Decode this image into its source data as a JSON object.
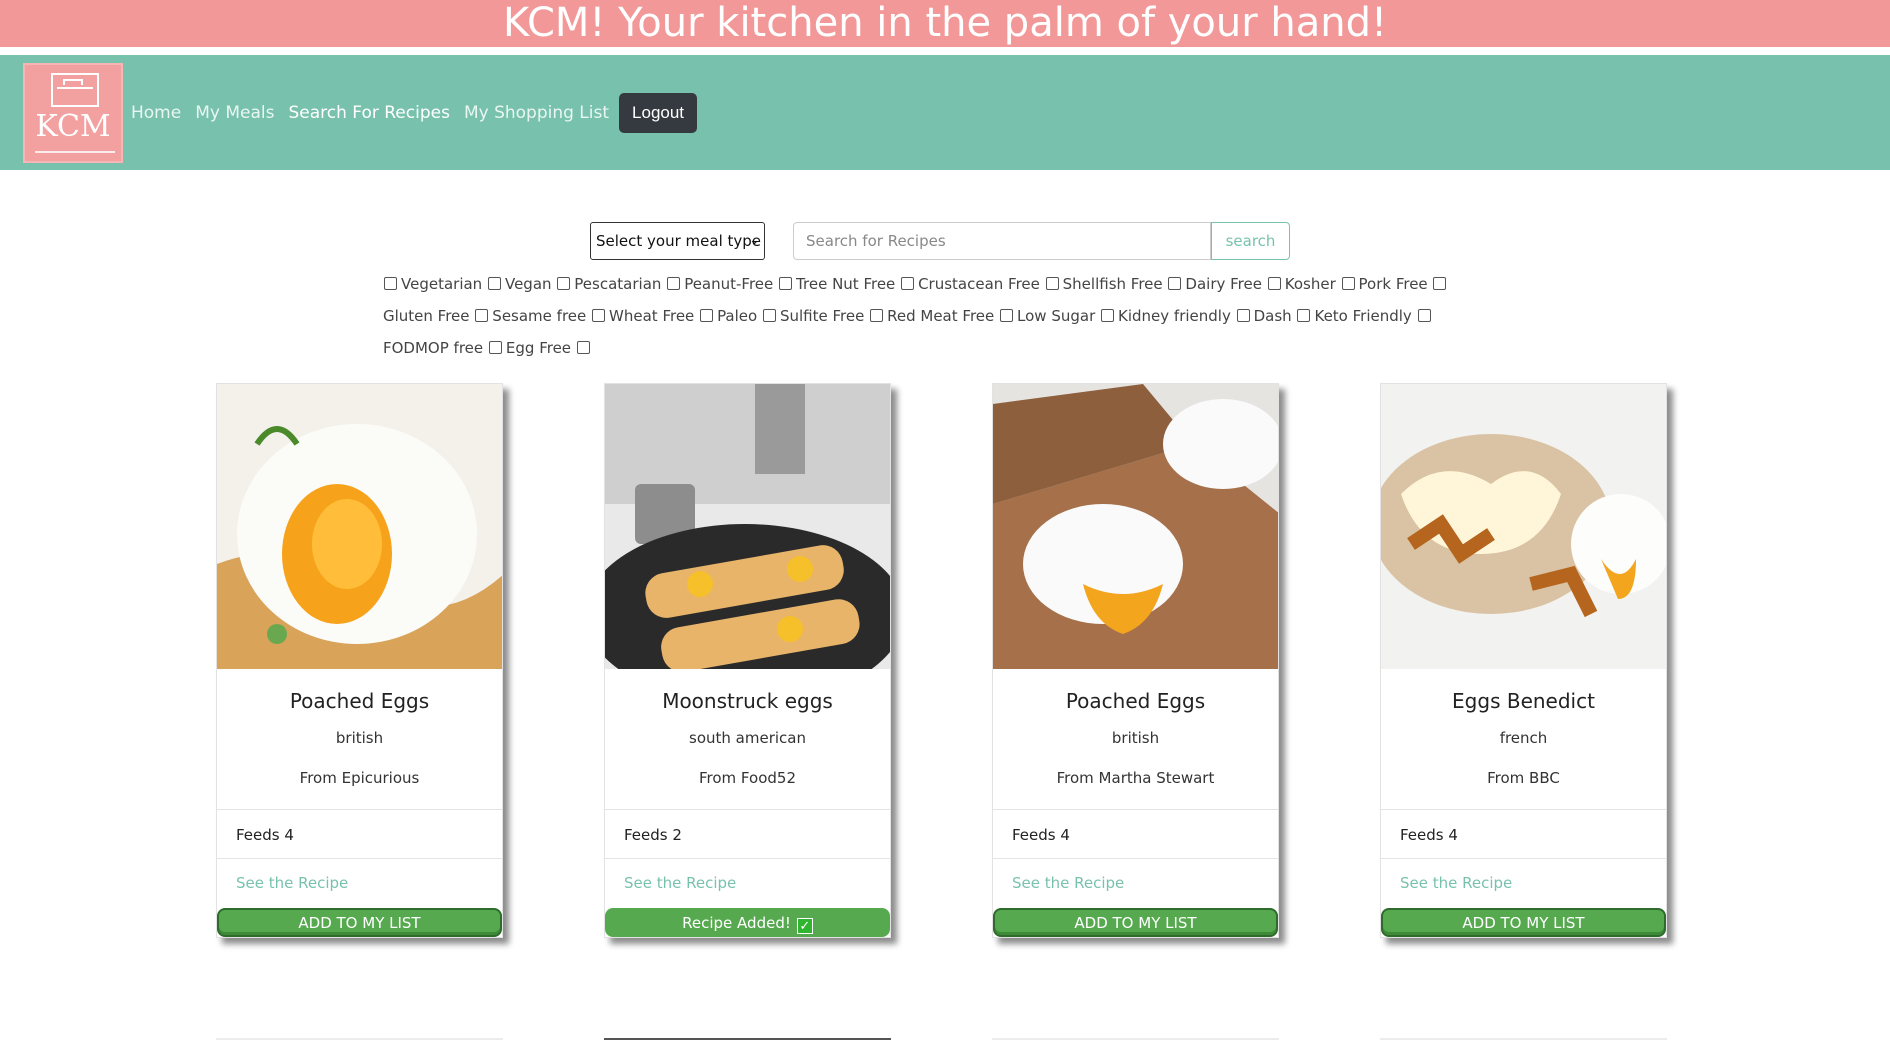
{
  "banner": {
    "text": "KCM! Your kitchen in the palm of your hand!"
  },
  "nav": {
    "logo_text": "KCM",
    "links": [
      {
        "label": "Home"
      },
      {
        "label": "My Meals"
      },
      {
        "label": "Search For Recipes"
      },
      {
        "label": "My Shopping List"
      }
    ],
    "logout_label": "Logout"
  },
  "search": {
    "meal_type_selected": "Select your meal type",
    "placeholder": "Search for Recipes",
    "button_label": "search"
  },
  "filters": [
    "Vegetarian",
    "Vegan",
    "Pescatarian",
    "Peanut-Free",
    "Tree Nut Free",
    "Crustacean Free",
    "Shellfish Free",
    "Dairy Free",
    "Kosher",
    "Pork Free",
    "Gluten Free",
    "Sesame free",
    "Wheat Free",
    "Paleo",
    "Sulfite Free",
    "Red Meat Free",
    "Low Sugar",
    "Kidney friendly",
    "Dash",
    "Keto Friendly",
    "FODMOP free",
    "Egg Free"
  ],
  "recipes": [
    {
      "title": "Poached Eggs",
      "cuisine": "british",
      "source": "From Epicurious",
      "feeds": "Feeds 4",
      "link": "See the Recipe",
      "button": "ADD TO MY LIST",
      "added": false
    },
    {
      "title": "Moonstruck eggs",
      "cuisine": "south american",
      "source": "From Food52",
      "feeds": "Feeds 2",
      "link": "See the Recipe",
      "button": "Recipe Added!",
      "added": true
    },
    {
      "title": "Poached Eggs",
      "cuisine": "british",
      "source": "From Martha Stewart",
      "feeds": "Feeds 4",
      "link": "See the Recipe",
      "button": "ADD TO MY LIST",
      "added": false
    },
    {
      "title": "Eggs Benedict",
      "cuisine": "french",
      "source": "From BBC",
      "feeds": "Feeds 4",
      "link": "See the Recipe",
      "button": "ADD TO MY LIST",
      "added": false
    }
  ],
  "colors": {
    "banner": "#f29898",
    "navbar": "#78c2ad",
    "accent": "#78c2ad",
    "button_green": "#56a94f"
  }
}
